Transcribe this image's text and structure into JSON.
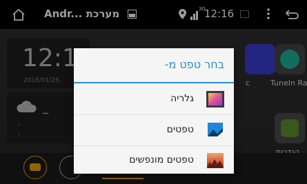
{
  "statusbar": {
    "app_title": "Andr... מערכת",
    "time": "12:16",
    "network_label": "3G"
  },
  "background": {
    "clock": "12:1",
    "date": "2016/01/26,",
    "weather_dash": "_",
    "apps": [
      {
        "label": "c",
        "color": "#3b3bd0"
      },
      {
        "label": "TuneIn Rai",
        "color": "#1fb09a"
      },
      {
        "label": "הגדרות",
        "color": "#5d8f2e"
      }
    ]
  },
  "dialog": {
    "title": "בחר טפט מ-",
    "items": [
      {
        "label": "גלריה",
        "icon": "gallery-icon"
      },
      {
        "label": "טפטים",
        "icon": "wallpapers-icon"
      },
      {
        "label": "טפטים מונפשים",
        "icon": "live-wallpapers-icon"
      }
    ]
  }
}
